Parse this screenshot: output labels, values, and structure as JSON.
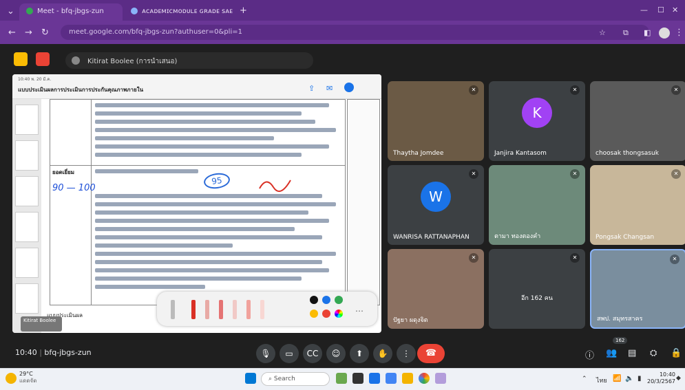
{
  "browser": {
    "tabs": [
      {
        "label": "Meet - bfq-jbgs-zun",
        "active": true
      },
      {
        "label": "ᴀᴄᴀᴅᴇᴍɪᴄᴍᴏᴅᴜʟᴇ ɢʀᴀᴅᴇ ꜱᴀᴇ — ɢᴏ…",
        "active": false
      }
    ],
    "url": "meet.google.com/bfq-jbgs-zun?authuser=0&pli=1",
    "new_tab_glyph": "+"
  },
  "meet": {
    "presenter_label": "Kitirat Boolee (การนำเสนอ)",
    "meeting_time": "10:40",
    "meeting_code": "bfq-jbgs-zun",
    "participant_badge": "162",
    "shared_doc": {
      "title": "แบบประเมินผลการประเมินการประกันคุณภาพภายใน",
      "status_time": "10:40 พ. 20 มี.ค.",
      "row_heading": "ยอดเยี่ยม",
      "score_handwriting": "90 — 100",
      "score_circled": "95",
      "tray_label": "แบบประเมินผล",
      "self_tile_label": "Kitirat Boolee"
    },
    "tiles": [
      {
        "name": "Thaytha Jomdee",
        "avatar": "",
        "color": "#6b5a45"
      },
      {
        "name": "Janjira Kantasom",
        "avatar": "K",
        "color": "#a142f4"
      },
      {
        "name": "choosak thongsasuk",
        "avatar": "",
        "color": "#5a5a5a"
      },
      {
        "name": "WANRISA RATTANAPHAN",
        "avatar": "W",
        "color": "#1a73e8"
      },
      {
        "name": "ตามา ทองตองคำ",
        "avatar": "",
        "color": "#6d8a7a"
      },
      {
        "name": "Pongsak Changsan",
        "avatar": "",
        "color": "#c8b79a"
      },
      {
        "name": "ปัฐยา ผดุงจิต",
        "avatar": "",
        "color": "#8b7061"
      },
      {
        "name": "อีก 162 คน",
        "avatar": "",
        "color": "#3c4043"
      },
      {
        "name": "สพป. สมุทรสาคร",
        "avatar": "",
        "color": "#7a8e9e"
      }
    ]
  },
  "taskbar": {
    "weather_temp": "29°C",
    "weather_desc": "แดดจัด",
    "search_placeholder": "Search",
    "lang": "ไทย",
    "clock_time": "10:40",
    "clock_date": "20/3/2567"
  }
}
